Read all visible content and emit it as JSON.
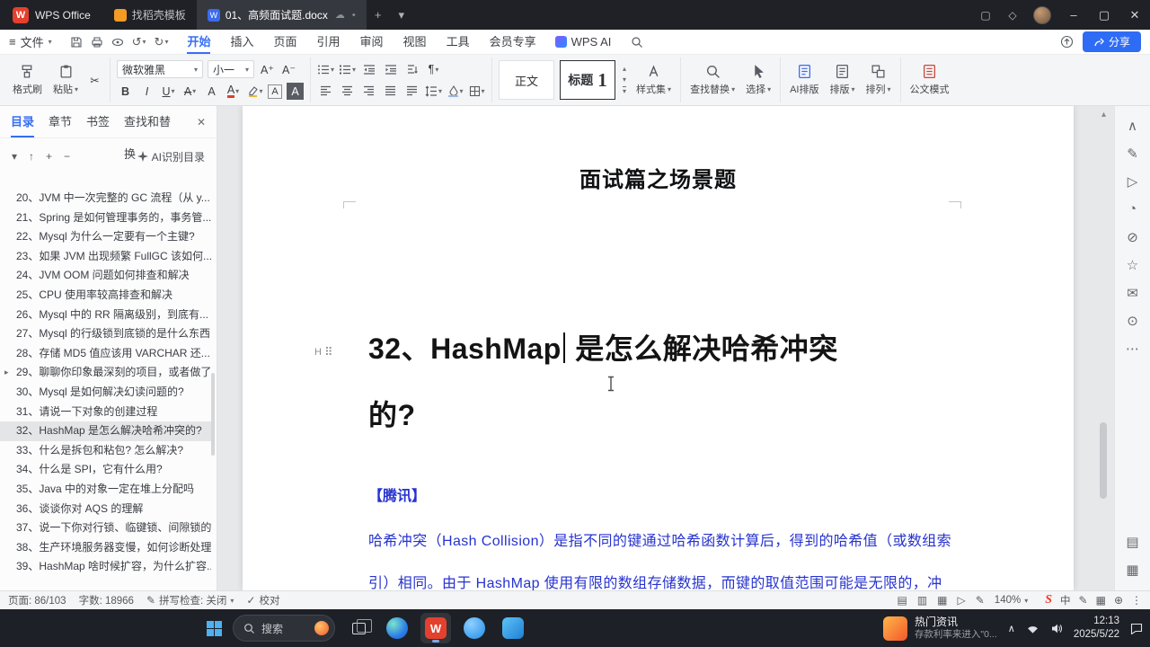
{
  "colors": {
    "accent": "#366ef4",
    "doc_text_blue": "#2733cf",
    "wps_red": "#e4402e",
    "titlebar_bg": "#1f2126",
    "taskbar_bg": "#1d2026"
  },
  "titlebar": {
    "app_name": "WPS Office",
    "home_tab": "找稻壳模板",
    "doc_tab": "01、高频面试题.docx"
  },
  "menubar": {
    "file": "文件",
    "items": [
      "开始",
      "插入",
      "页面",
      "引用",
      "审阅",
      "视图",
      "工具",
      "会员专享"
    ],
    "wps_ai": "WPS AI",
    "share": "分享"
  },
  "ribbon": {
    "format_painter": "格式刷",
    "paste": "粘贴",
    "font_name": "微软雅黑",
    "font_size": "小一",
    "grow_font": "A⁺",
    "shrink_font": "A⁻",
    "bold": "B",
    "italic": "I",
    "underline": "U",
    "strike": "A",
    "clear_format": "A",
    "font_color": "A",
    "char_border": "A",
    "char_shading": "A",
    "pilcrow": "¶",
    "style_body": "正文",
    "style_h1_name": "标题",
    "style_h1_num": "1",
    "style_set": "样式集",
    "find_replace": "查找替换",
    "select": "选择",
    "ai_layout": "AI排版",
    "layout": "排版",
    "arrange": "排列",
    "doc_mode": "公文模式"
  },
  "sidebar": {
    "tabs": [
      "目录",
      "章节",
      "书签",
      "查找和替换"
    ],
    "ai_button": "AI识别目录",
    "items": [
      "20、JVM 中一次完整的 GC 流程（从 y...",
      "21、Spring 是如何管理事务的，事务管...",
      "22、Mysql 为什么一定要有一个主键?",
      "23、如果 JVM 出现频繁 FullGC 该如何...",
      "24、JVM OOM 问题如何排查和解决",
      "25、CPU 使用率较高排查和解决",
      "26、Mysql 中的 RR 隔离级别，到底有...",
      "27、Mysql 的行级锁到底锁的是什么东西...",
      "28、存储 MD5 值应该用 VARCHAR 还...",
      "29、聊聊你印象最深刻的项目，或者做了...",
      "30、Mysql 是如何解决幻读问题的?",
      "31、请说一下对象的创建过程",
      "32、HashMap 是怎么解决哈希冲突的?",
      "33、什么是拆包和粘包? 怎么解决?",
      "34、什么是 SPI，它有什么用?",
      "35、Java 中的对象一定在堆上分配吗",
      "36、谈谈你对 AQS 的理解",
      "37、说一下你对行锁、临键锁、间隙锁的...",
      "38、生产环境服务器变慢，如何诊断处理...",
      "39、HashMap 啥时候扩容，为什么扩容..."
    ]
  },
  "document": {
    "page_title": "面试篇之场景题",
    "heading_part1": "32、HashMap",
    "heading_part2": " 是怎么解决哈希冲突",
    "heading_line2": "的?",
    "source_tag": "【腾讯】",
    "body_line1": "哈希冲突（Hash Collision）是指不同的键通过哈希函数计算后，得到的哈希值（或数组索",
    "body_line2": "引）相同。由于 HashMap 使用有限的数组存储数据，而键的取值范围可能是无限的，冲"
  },
  "statusbar": {
    "page": "页面: 86/103",
    "words": "字数: 18966",
    "spellcheck": "拼写检查: 关闭",
    "proofread": "校对",
    "zoom": "140%"
  },
  "ime": {
    "logo": "S",
    "mode": "中"
  },
  "taskbar": {
    "search": "搜索",
    "news_title": "热门资讯",
    "news_sub": "存款利率来进入\"0...",
    "time": "12:13",
    "date": "2025/5/22",
    "wps_letter": "W"
  },
  "icons": {
    "caret_down": "▾",
    "caret_up": "▴",
    "chevron_up": "∧",
    "expand": "▸",
    "close": "✕",
    "minimize": "–",
    "maximize": "▢",
    "plus": "+",
    "minus": "−",
    "hamburger": "≡",
    "drag": "⠿",
    "h_badge": "H",
    "undo": "↺",
    "redo": "↻",
    "scissors": "✂",
    "cloud": "☁",
    "dot": "•",
    "up_arrow": "↑",
    "diamond": "◇",
    "pen": "✎",
    "mail": "✉",
    "star": "☆",
    "circle": "◯",
    "circle_q": "◔",
    "slash": "⊘",
    "dot_circle": "⊙",
    "tri_right": "▷",
    "grid1": "▤",
    "grid2": "▥",
    "grid3": "▦",
    "check": "✓",
    "ellipsis": "⋯",
    "vdots": "⋮",
    "oplus": "⊕",
    "wps_letter": "W"
  }
}
